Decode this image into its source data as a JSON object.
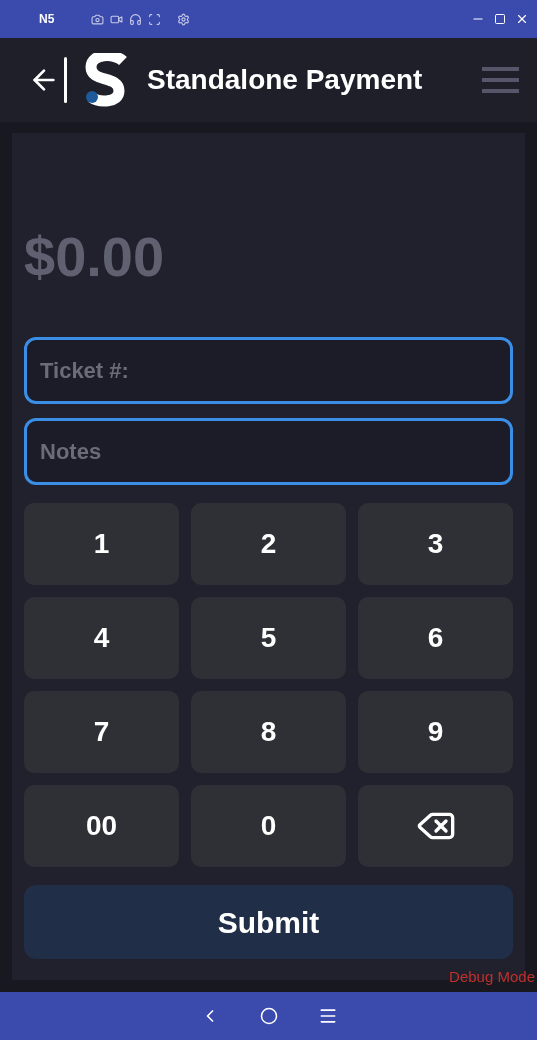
{
  "emulator_bar": {
    "device": "N5"
  },
  "header": {
    "title": "Standalone Payment"
  },
  "amount": "$0.00",
  "fields": [
    {
      "placeholder": "Ticket #:"
    },
    {
      "placeholder": "Notes"
    }
  ],
  "keypad": [
    {
      "kind": "digit",
      "label": "1"
    },
    {
      "kind": "digit",
      "label": "2"
    },
    {
      "kind": "digit",
      "label": "3"
    },
    {
      "kind": "digit",
      "label": "4"
    },
    {
      "kind": "digit",
      "label": "5"
    },
    {
      "kind": "digit",
      "label": "6"
    },
    {
      "kind": "digit",
      "label": "7"
    },
    {
      "kind": "digit",
      "label": "8"
    },
    {
      "kind": "digit",
      "label": "9"
    },
    {
      "kind": "digit",
      "label": "00"
    },
    {
      "kind": "digit",
      "label": "0"
    },
    {
      "kind": "backspace"
    }
  ],
  "submit": "Submit",
  "debug_label": "Debug Mode"
}
